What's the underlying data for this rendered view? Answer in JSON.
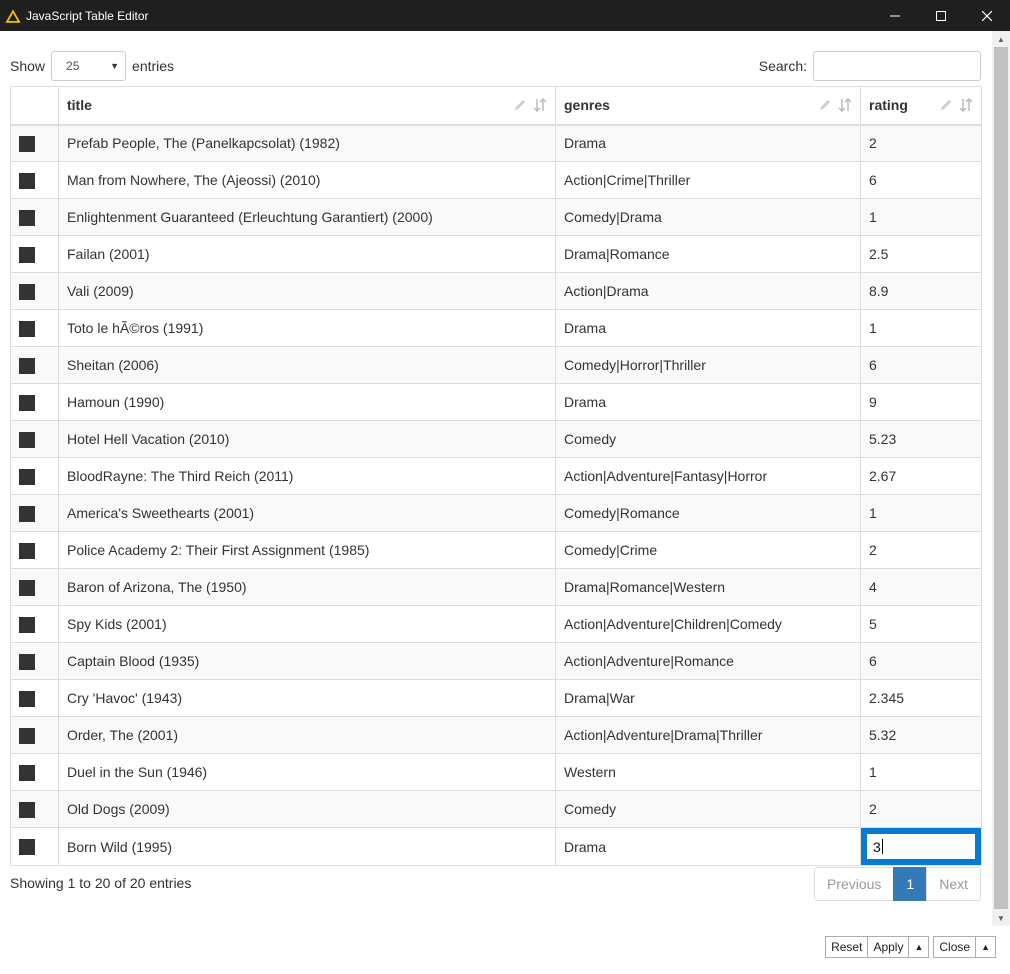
{
  "window": {
    "title": "JavaScript Table Editor",
    "controls": [
      "—",
      "☐",
      "✕"
    ]
  },
  "length_menu": {
    "show_label": "Show",
    "selected": "25",
    "entries_label": "entries"
  },
  "search": {
    "label": "Search:",
    "value": ""
  },
  "table": {
    "columns": [
      "",
      "title",
      "genres",
      "rating"
    ],
    "rows": [
      {
        "title": "Prefab People, The (Panelkapcsolat) (1982)",
        "genres": "Drama",
        "rating": "2"
      },
      {
        "title": "Man from Nowhere, The (Ajeossi) (2010)",
        "genres": "Action|Crime|Thriller",
        "rating": "6"
      },
      {
        "title": "Enlightenment Guaranteed (Erleuchtung Garantiert) (2000)",
        "genres": "Comedy|Drama",
        "rating": "1"
      },
      {
        "title": "Failan (2001)",
        "genres": "Drama|Romance",
        "rating": "2.5"
      },
      {
        "title": "Vali (2009)",
        "genres": "Action|Drama",
        "rating": "8.9"
      },
      {
        "title": "Toto le hÃ©ros (1991)",
        "genres": "Drama",
        "rating": "1"
      },
      {
        "title": "Sheitan (2006)",
        "genres": "Comedy|Horror|Thriller",
        "rating": "6"
      },
      {
        "title": "Hamoun (1990)",
        "genres": "Drama",
        "rating": "9"
      },
      {
        "title": "Hotel Hell Vacation (2010)",
        "genres": "Comedy",
        "rating": "5.23"
      },
      {
        "title": "BloodRayne: The Third Reich (2011)",
        "genres": "Action|Adventure|Fantasy|Horror",
        "rating": "2.67"
      },
      {
        "title": "America's Sweethearts (2001)",
        "genres": "Comedy|Romance",
        "rating": "1"
      },
      {
        "title": "Police Academy 2: Their First Assignment (1985)",
        "genres": "Comedy|Crime",
        "rating": "2"
      },
      {
        "title": "Baron of Arizona, The (1950)",
        "genres": "Drama|Romance|Western",
        "rating": "4"
      },
      {
        "title": "Spy Kids (2001)",
        "genres": "Action|Adventure|Children|Comedy",
        "rating": "5"
      },
      {
        "title": "Captain Blood (1935)",
        "genres": "Action|Adventure|Romance",
        "rating": "6"
      },
      {
        "title": "Cry 'Havoc' (1943)",
        "genres": "Drama|War",
        "rating": "2.345"
      },
      {
        "title": "Order, The (2001)",
        "genres": "Action|Adventure|Drama|Thriller",
        "rating": "5.32"
      },
      {
        "title": "Duel in the Sun (1946)",
        "genres": "Western",
        "rating": "1"
      },
      {
        "title": "Old Dogs (2009)",
        "genres": "Comedy",
        "rating": "2"
      },
      {
        "title": "Born Wild (1995)",
        "genres": "Drama",
        "rating": "3",
        "editing": true
      }
    ]
  },
  "info": "Showing 1 to 20 of 20 entries",
  "pagination": {
    "previous": "Previous",
    "page": "1",
    "next": "Next"
  },
  "bottom_buttons": {
    "reset": "Reset",
    "apply": "Apply",
    "close": "Close"
  },
  "colors": {
    "titlebar": "#1f1f1f",
    "accent": "#337ab7",
    "edit_border": "#0a7acc",
    "warning_icon": "#f5c400"
  }
}
